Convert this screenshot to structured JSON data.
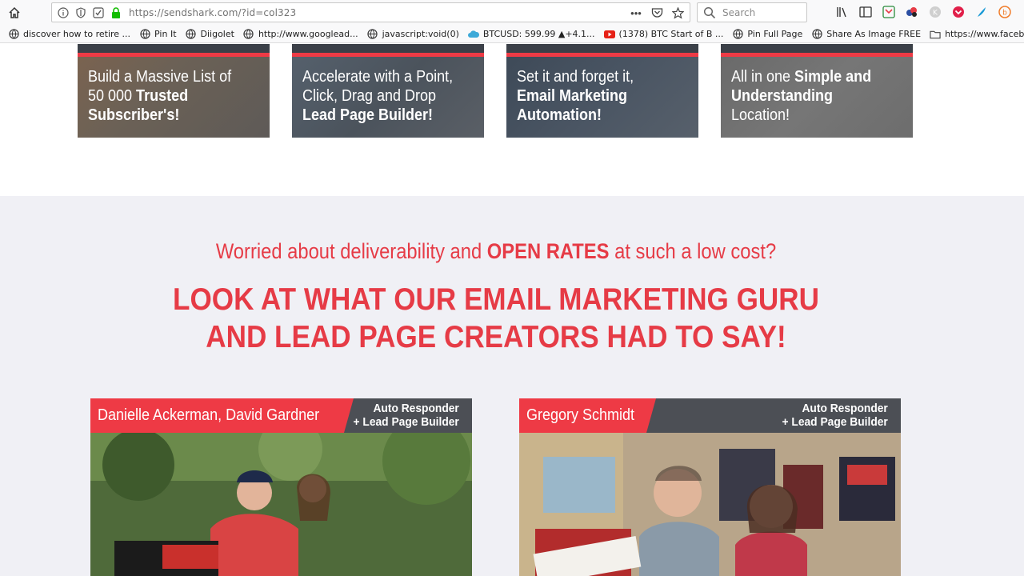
{
  "browser": {
    "url": "https://sendshark.com/?id=col323",
    "search_placeholder": "Search",
    "bookmarks": [
      "discover how to retire ...",
      "Pin It",
      "Diigolet",
      "http://www.googlead...",
      "javascript:void(0)",
      "BTCUSD: 599.99 ▲+4.1...",
      "(1378) BTC Start of B ...",
      "Pin Full Page",
      "Share As Image FREE",
      "https://www.facebook..."
    ]
  },
  "features": [
    {
      "l1": "Build a Massive List of",
      "l2a": "50 000 ",
      "l2b": "Trusted",
      "l3b": "Subscriber's!"
    },
    {
      "l1": "Accelerate with a Point,",
      "l2": "Click, Drag and Drop",
      "l3b": "Lead Page Builder!"
    },
    {
      "l1": "Set it and forget it,",
      "l2b": "Email Marketing",
      "l3b": "Automation!"
    },
    {
      "l1a": "All in one ",
      "l1b": "Simple and",
      "l2b": "Understanding",
      "l3": "Location!"
    }
  ],
  "section": {
    "subhead_a": "Worried about deliverability and ",
    "subhead_b": "OPEN RATES",
    "subhead_c": " at such a low cost?",
    "headline_1": "LOOK AT WHAT OUR EMAIL MARKETING GURU",
    "headline_2": "AND LEAD PAGE CREATORS HAD TO SAY!"
  },
  "testimonials": [
    {
      "name": "Danielle Ackerman, David Gardner",
      "tag1": "Auto Responder",
      "tag2": "+ Lead Page Builder"
    },
    {
      "name": "Gregory Schmidt",
      "tag1": "Auto Responder",
      "tag2": "+ Lead Page Builder"
    }
  ],
  "colors": {
    "accent": "#e63b46",
    "dark_bar": "#4c4f55",
    "grey_band": "#f0f0f5"
  }
}
